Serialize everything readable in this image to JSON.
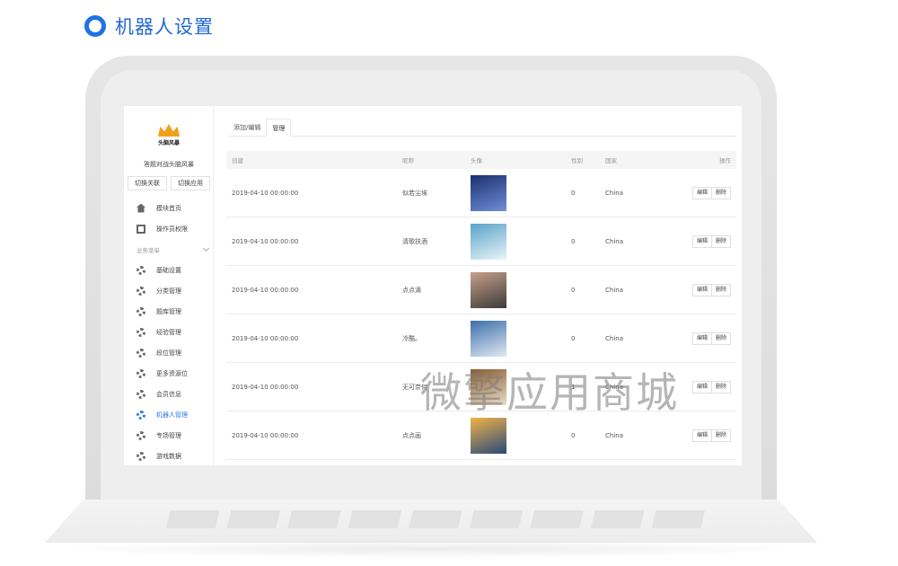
{
  "heading": {
    "title": "机器人设置"
  },
  "sidebar": {
    "logo_text": "头脑风暴",
    "title": "答题对战头脑风暴",
    "switch_buttons": [
      "切换关联",
      "切换应用"
    ],
    "items": [
      {
        "label": "模块首页",
        "icon": "home-icon"
      },
      {
        "label": "操作员权限",
        "icon": "document-icon"
      },
      {
        "label": "业务菜单",
        "icon": "chevron-down-icon",
        "section": true
      },
      {
        "label": "基础设置",
        "icon": "gear-icon"
      },
      {
        "label": "分类管理",
        "icon": "gear-icon"
      },
      {
        "label": "题库管理",
        "icon": "gear-icon"
      },
      {
        "label": "经验管理",
        "icon": "gear-icon"
      },
      {
        "label": "段位管理",
        "icon": "gear-icon"
      },
      {
        "label": "更多资源位",
        "icon": "gear-icon"
      },
      {
        "label": "会员信息",
        "icon": "gear-icon"
      },
      {
        "label": "机器人管理",
        "icon": "gear-icon",
        "active": true
      },
      {
        "label": "专场管理",
        "icon": "gear-icon"
      },
      {
        "label": "游戏数据",
        "icon": "gear-icon"
      }
    ]
  },
  "tabs": [
    {
      "label": "添加/编辑"
    },
    {
      "label": "管理",
      "active": true
    }
  ],
  "table": {
    "headers": {
      "date": "创建",
      "nick": "昵称",
      "avatar": "头像",
      "sex": "性别",
      "country": "国家",
      "ops": "操作"
    },
    "rows": [
      {
        "date": "2019-04-10 00:00:00",
        "nick": "似若尘埃",
        "sex": "0",
        "country": "China",
        "avatar_colors": [
          "#1b2f6e",
          "#6f8fd6"
        ]
      },
      {
        "date": "2019-04-10 00:00:00",
        "nick": "清歌扶酒",
        "sex": "0",
        "country": "China",
        "avatar_colors": [
          "#5aa3c9",
          "#e9f4f8"
        ]
      },
      {
        "date": "2019-04-10 00:00:00",
        "nick": "点点滴",
        "sex": "0",
        "country": "China",
        "avatar_colors": [
          "#c4a08a",
          "#3f3a3a"
        ]
      },
      {
        "date": "2019-04-10 00:00:00",
        "nick": "冷酷。",
        "sex": "0",
        "country": "China",
        "avatar_colors": [
          "#3e6fa9",
          "#dfe9f3"
        ]
      },
      {
        "date": "2019-04-10 00:00:00",
        "nick": "无可奈何",
        "sex": "1",
        "country": "China",
        "avatar_colors": [
          "#8a5c2f",
          "#e9dcc8"
        ]
      },
      {
        "date": "2019-04-10 00:00:00",
        "nick": "点点画",
        "sex": "0",
        "country": "China",
        "avatar_colors": [
          "#f0b247",
          "#2a4a7a"
        ]
      }
    ],
    "edit_label": "编辑",
    "delete_label": "删除"
  },
  "watermark": "微擎应用商城",
  "colors": {
    "accent": "#2b78e4",
    "heading": "#2268d6"
  }
}
